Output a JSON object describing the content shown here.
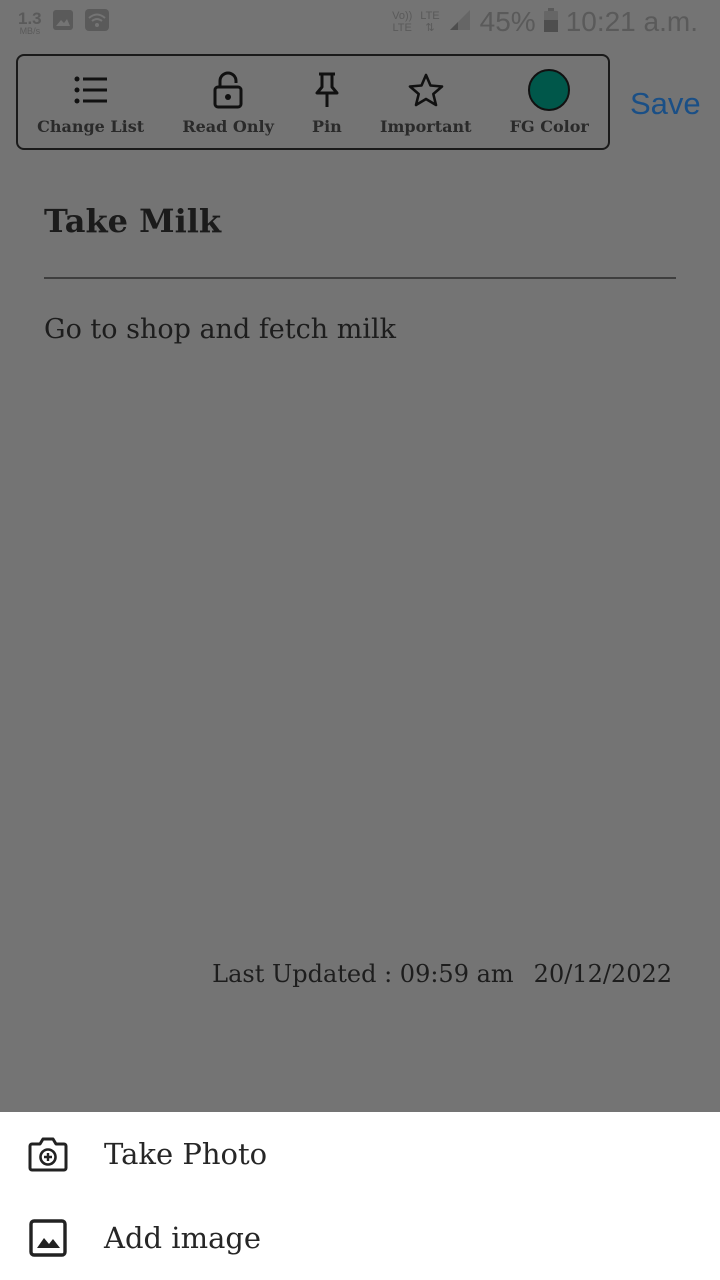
{
  "status_bar": {
    "speed_value": "1.3",
    "speed_unit": "MB/s",
    "volte": "Vo))",
    "lte_top": "LTE",
    "lte_label": "LTE",
    "battery_percent": "45%",
    "time": "10:21 a.m."
  },
  "toolbar": {
    "items": [
      {
        "label": "Change List",
        "icon": "list-icon"
      },
      {
        "label": "Read Only",
        "icon": "unlock-icon"
      },
      {
        "label": "Pin",
        "icon": "pin-icon"
      },
      {
        "label": "Important",
        "icon": "star-icon"
      },
      {
        "label": "FG Color",
        "icon": "color-swatch"
      }
    ],
    "fg_color": "#00574a",
    "save_label": "Save"
  },
  "note": {
    "title": "Take Milk",
    "body": "Go to shop and fetch milk",
    "last_updated_label": "Last Updated : 09:59 am",
    "last_updated_date": "20/12/2022"
  },
  "bottom_sheet": {
    "items": [
      {
        "label": "Take Photo",
        "icon": "camera-icon"
      },
      {
        "label": "Add image",
        "icon": "image-icon"
      }
    ]
  },
  "colors": {
    "overlay_background": "#747474",
    "accent": "#1a4f86",
    "sheet_background": "#ffffff"
  }
}
